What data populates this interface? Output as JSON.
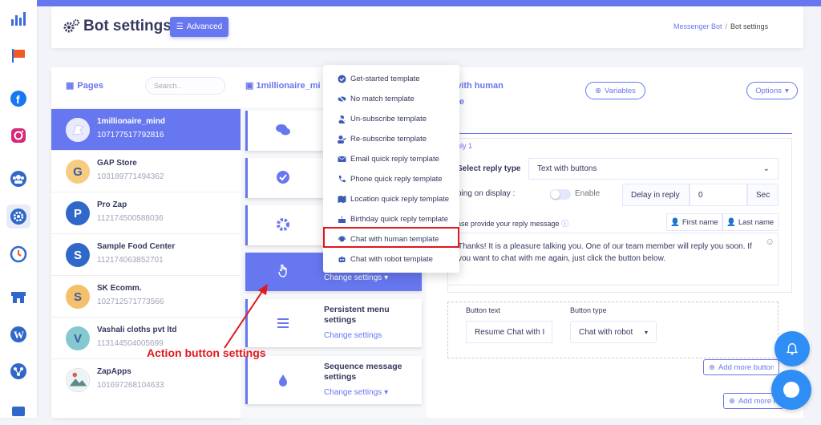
{
  "header": {
    "title": "Bot settings",
    "advanced_label": "Advanced",
    "breadcrumb": {
      "parent": "Messenger Bot",
      "separator": "/",
      "current": "Bot settings"
    }
  },
  "pages": {
    "title": "Pages",
    "search_placeholder": "Search..",
    "items": [
      {
        "name": "1millionaire_mind",
        "id": "107177517792816",
        "avatar_letter": "",
        "color": "#6777ef"
      },
      {
        "name": "GAP Store",
        "id": "103189771494362",
        "avatar_letter": "G",
        "color": "#f8cc7f"
      },
      {
        "name": "Pro Zap",
        "id": "112174500588036",
        "avatar_letter": "P",
        "color": "#2f68c9"
      },
      {
        "name": "Sample Food Center",
        "id": "112174063852701",
        "avatar_letter": "S",
        "color": "#2f68c9"
      },
      {
        "name": "SK Ecomm.",
        "id": "102712571773566",
        "avatar_letter": "S",
        "color": "#f5c06a"
      },
      {
        "name": "Vashali cloths pvt ltd",
        "id": "113144504005699",
        "avatar_letter": "V",
        "color": "#86c8cf"
      },
      {
        "name": "ZapApps",
        "id": "101697268104633",
        "avatar_letter": "",
        "color": "#ffffff"
      }
    ]
  },
  "middle": {
    "page_title": "1millionaire_mi",
    "cards": [
      {
        "icon": "comments-icon",
        "title": "",
        "link": ""
      },
      {
        "icon": "check-circle-icon",
        "title": "",
        "link": ""
      },
      {
        "icon": "gear-icon",
        "title": "",
        "link": ""
      },
      {
        "icon": "hand-pointer-icon",
        "title": "",
        "link": "Change settings"
      },
      {
        "icon": "bars-icon",
        "title": "Persistent menu settings",
        "link": "Change settings"
      },
      {
        "icon": "droplet-icon",
        "title": "Sequence message settings",
        "link": "Change settings"
      }
    ]
  },
  "dropdown": {
    "items": [
      {
        "label": "Get-started template",
        "icon": "check-circle-icon"
      },
      {
        "label": "No match template",
        "icon": "eye-slash-icon"
      },
      {
        "label": "Un-subscribe template",
        "icon": "user-slash-icon"
      },
      {
        "label": "Re-subscribe template",
        "icon": "user-check-icon"
      },
      {
        "label": "Email quick reply template",
        "icon": "envelope-icon"
      },
      {
        "label": "Phone quick reply template",
        "icon": "phone-icon"
      },
      {
        "label": "Location quick reply template",
        "icon": "map-icon"
      },
      {
        "label": "Birthday quick reply template",
        "icon": "birthday-cake-icon"
      },
      {
        "label": "Chat with human template",
        "icon": "headset-icon"
      },
      {
        "label": "Chat with robot template",
        "icon": "robot-icon"
      }
    ],
    "highlighted_index": 8
  },
  "right": {
    "title_line1": "t with human",
    "title_line2": "late",
    "variables_label": "Variables",
    "options_label": "Options",
    "reply_label": "ply 1",
    "select_reply_type_label": "Select reply type",
    "reply_type_value": "Text with buttons",
    "typing_label": "ping on display :",
    "enable_label": "Enable",
    "delay_label": "Delay in reply",
    "delay_value": "0",
    "sec_label": "Sec",
    "message_label": "ase provide your reply message",
    "first_name_label": "First name",
    "last_name_label": "Last name",
    "message_text": "Thanks! It is a pleasure talking you. One of our team member will reply you soon. If you want to chat with me again, just click the button below.",
    "button_text_label": "Button text",
    "button_text_value": "Resume Chat with I",
    "button_type_label": "Button type",
    "button_type_value": "Chat with robot",
    "add_more_button_label": "Add more button",
    "add_more_reply_label": "Add more rep"
  },
  "annotation": {
    "text": "Action button settings",
    "color": "#e0171b"
  },
  "colors": {
    "accent": "#6777ef",
    "fab": "#2e8ef5"
  }
}
